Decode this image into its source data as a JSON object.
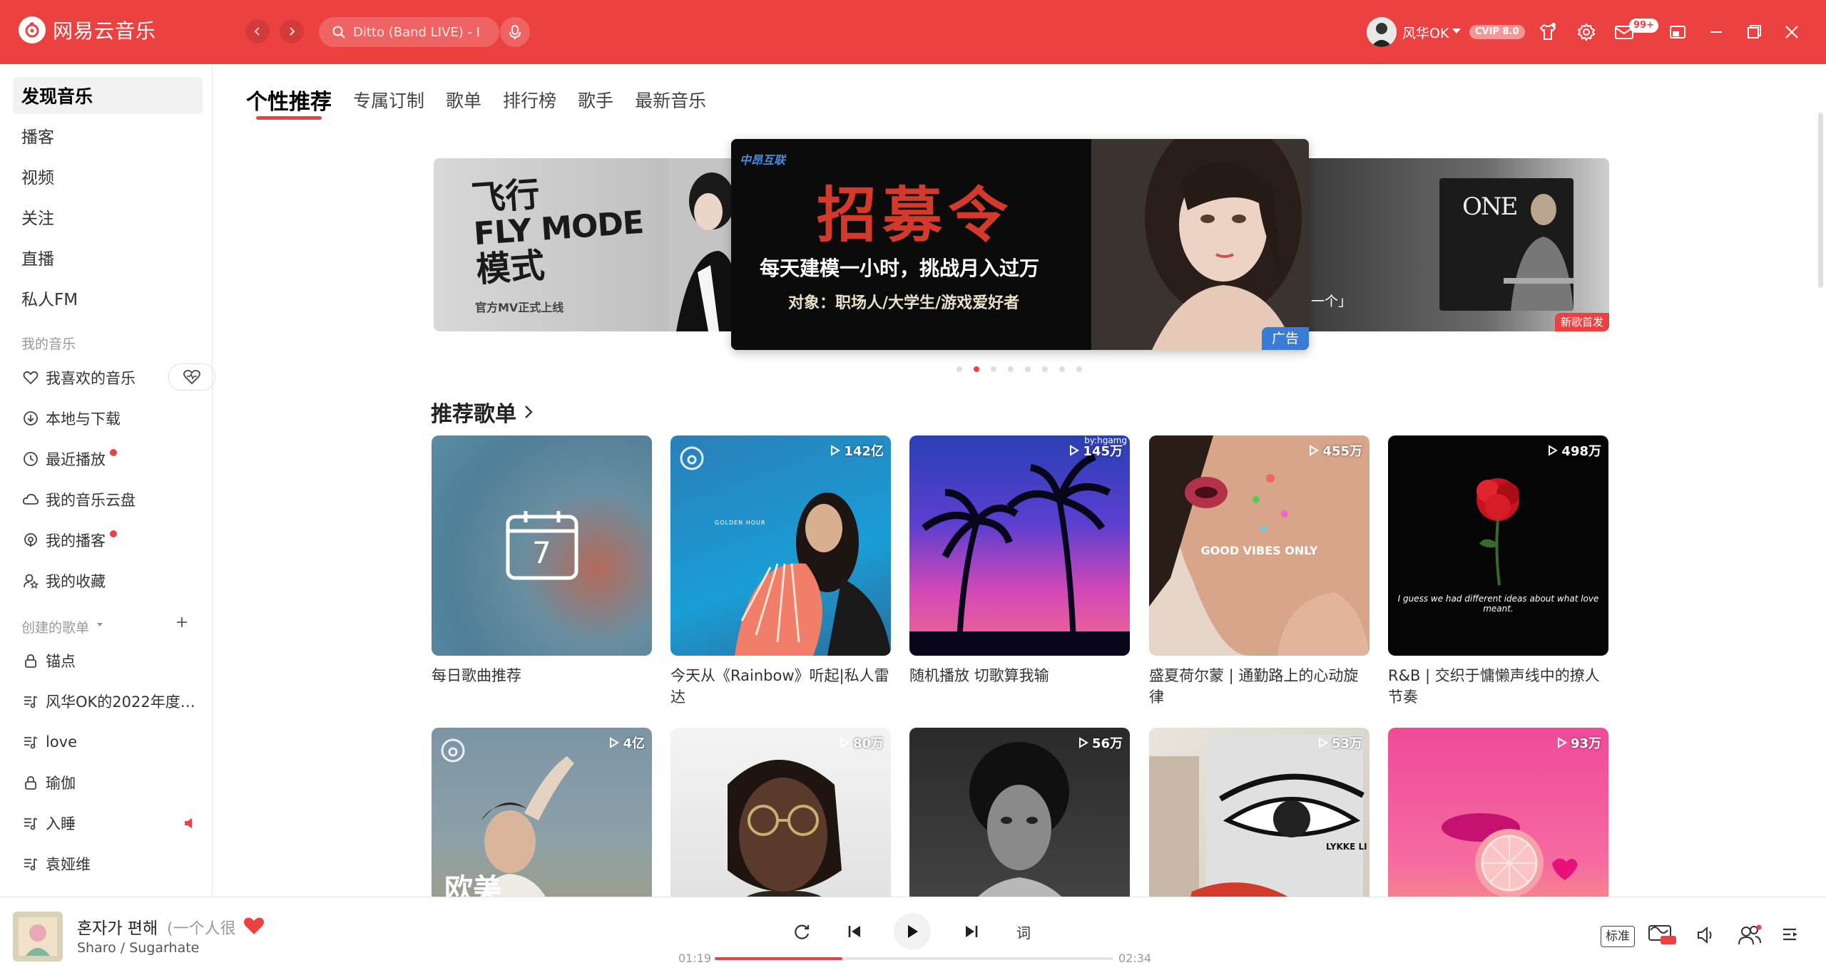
{
  "app": {
    "name": "网易云音乐",
    "search_placeholder": "Ditto (Band LIVE) - I",
    "user": {
      "name": "风华OK",
      "vip_badge": "CVIP 8.0"
    },
    "msg_badge": "99+",
    "brand_color": "#ec4141"
  },
  "sidebar": {
    "main_items": [
      {
        "label": "发现音乐"
      },
      {
        "label": "播客"
      },
      {
        "label": "视频"
      },
      {
        "label": "关注"
      },
      {
        "label": "直播"
      },
      {
        "label": "私人FM"
      }
    ],
    "my_music_label": "我的音乐",
    "my_music": [
      {
        "label": "我喜欢的音乐",
        "icon": "heart-icon"
      },
      {
        "label": "本地与下载",
        "icon": "download-icon"
      },
      {
        "label": "最近播放",
        "icon": "clock-icon"
      },
      {
        "label": "我的音乐云盘",
        "icon": "cloud-icon"
      },
      {
        "label": "我的播客",
        "icon": "podcast-icon"
      },
      {
        "label": "我的收藏",
        "icon": "user-star-icon"
      }
    ],
    "created_label": "创建的歌单",
    "playlists": [
      {
        "label": "锚点",
        "icon": "lock-icon"
      },
      {
        "label": "风华OK的2022年度…",
        "icon": "playlist-icon"
      },
      {
        "label": "love",
        "icon": "playlist-icon"
      },
      {
        "label": "瑜伽",
        "icon": "lock-icon"
      },
      {
        "label": "入睡",
        "icon": "playlist-icon"
      },
      {
        "label": "袁娅维",
        "icon": "playlist-icon"
      }
    ]
  },
  "tabs": [
    {
      "label": "个性推荐"
    },
    {
      "label": "专属订制"
    },
    {
      "label": "歌单"
    },
    {
      "label": "排行榜"
    },
    {
      "label": "歌手"
    },
    {
      "label": "最新音乐"
    }
  ],
  "banner": {
    "left": {
      "title_cn": "飞行",
      "title_en": "FLY MODE",
      "title_cn2": "模式",
      "caption": "官方MV正式上线"
    },
    "center": {
      "brand": "中昂互联",
      "headline": "招募令",
      "line1": "每天建模一小时，挑战月入过万",
      "line2": "对象：职场人/大学生/游戏爱好者",
      "badge": "广告"
    },
    "right": {
      "text": "一个」",
      "album": "ONE",
      "badge": "新歌首发"
    },
    "dots_count": 8,
    "active_dot": 1
  },
  "section": {
    "title": "推荐歌单"
  },
  "playlists_grid": [
    {
      "title": "每日歌曲推荐",
      "count": "",
      "calendar_day": "7"
    },
    {
      "title": "今天从《Rainbow》听起|私人雷达",
      "count": "142亿",
      "cover_text": "GOLDEN HOUR"
    },
    {
      "title": "随机播放 切歌算我输",
      "count": "145万",
      "cover_text": "by:hgamg"
    },
    {
      "title": "盛夏荷尔蒙 | 通勤路上的心动旋律",
      "count": "455万",
      "cover_text": "GOOD VIBES ONLY"
    },
    {
      "title": "R&B | 交织于慵懒声线中的撩人节奏",
      "count": "498万",
      "cover_text": "I guess we had different ideas about what love meant."
    },
    {
      "title": "",
      "count": "4亿",
      "cover_text": "欧美"
    },
    {
      "title": "",
      "count": "80万"
    },
    {
      "title": "",
      "count": "56万"
    },
    {
      "title": "",
      "count": "53万",
      "cover_text": "LYKKE LI"
    },
    {
      "title": "",
      "count": "93万"
    }
  ],
  "player": {
    "title": "혼자가 편해",
    "subtitle": "(一个人很",
    "artist": "Sharo / Sugarhate",
    "current_time": "01:19",
    "total_time": "02:34",
    "progress": 0.32,
    "lyric_label": "词",
    "quality": "标准"
  }
}
